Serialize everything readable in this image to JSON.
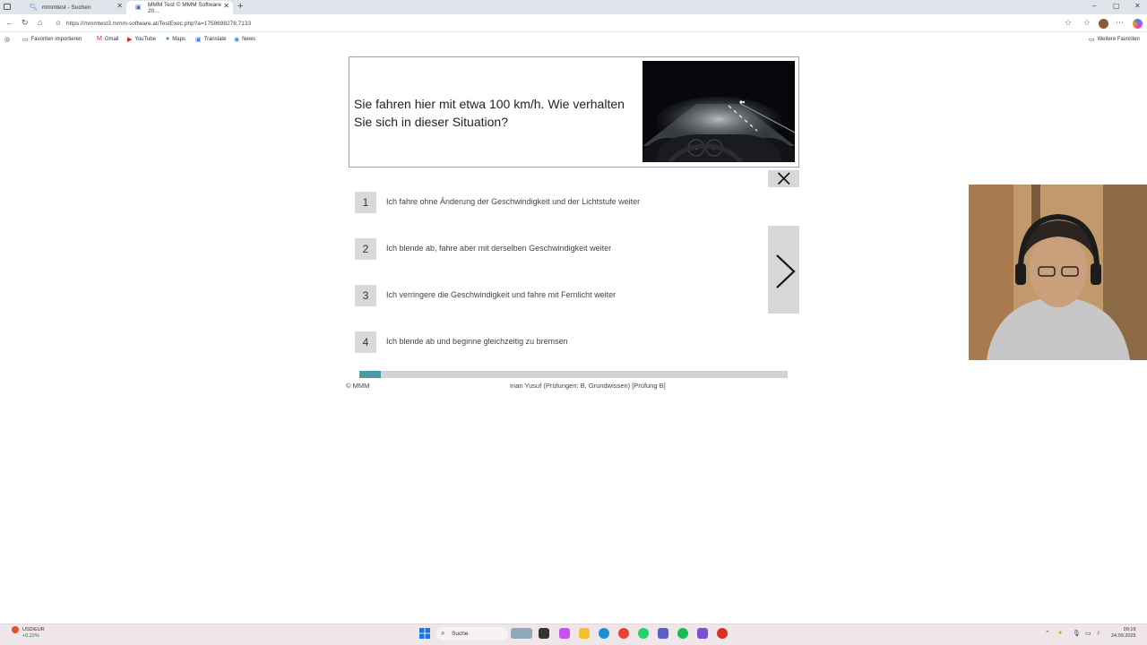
{
  "browser": {
    "tabs": [
      {
        "title": "mmmtest - Suchen"
      },
      {
        "title": "MMM Test © MMM Software 20..."
      }
    ],
    "url": "https://mmmtest3.mmm-software.at/TestExec.php?a=1758698278.7133",
    "bookmarks": [
      {
        "label": "Favoriten importieren"
      },
      {
        "label": "Gmail"
      },
      {
        "label": "YouTube"
      },
      {
        "label": "Maps"
      },
      {
        "label": "Translate"
      },
      {
        "label": "News"
      }
    ],
    "other_favorites": "Weitere Favoriten"
  },
  "question": {
    "text": "Sie fahren hier mit etwa 100 km/h. Wie verhalten Sie sich in dieser Situation?"
  },
  "answers": [
    {
      "number": "1",
      "text": "Ich fahre ohne Änderung der Geschwindigkeit und der Lichtstufe weiter"
    },
    {
      "number": "2",
      "text": "Ich blende ab, fahre aber mit derselben Geschwindigkeit weiter"
    },
    {
      "number": "3",
      "text": "Ich verringere die Geschwindigkeit und fahre mit Fernlicht weiter"
    },
    {
      "number": "4",
      "text": "Ich blende ab und beginne gleichzeitig zu bremsen"
    }
  ],
  "progress": {
    "fraction": 0.05
  },
  "footer": {
    "copyright": "© MMM",
    "candidate": "Inan Yusuf (Prüfungen: B, Grundwissen) [Prüfung B]"
  },
  "taskbar": {
    "ticker_label": "USD/EUR",
    "ticker_change": "+0,22%",
    "search_placeholder": "Suche",
    "time": "09:19",
    "date": "24.09.2025"
  },
  "icons": {
    "close": "close-icon",
    "next": "chevron-right-icon"
  },
  "colors": {
    "progress_fill": "#4a9aa6",
    "progress_track": "#d3d3d3",
    "answer_number_bg": "#d9d9d9",
    "nav_button_bg": "#d7d7d7"
  }
}
